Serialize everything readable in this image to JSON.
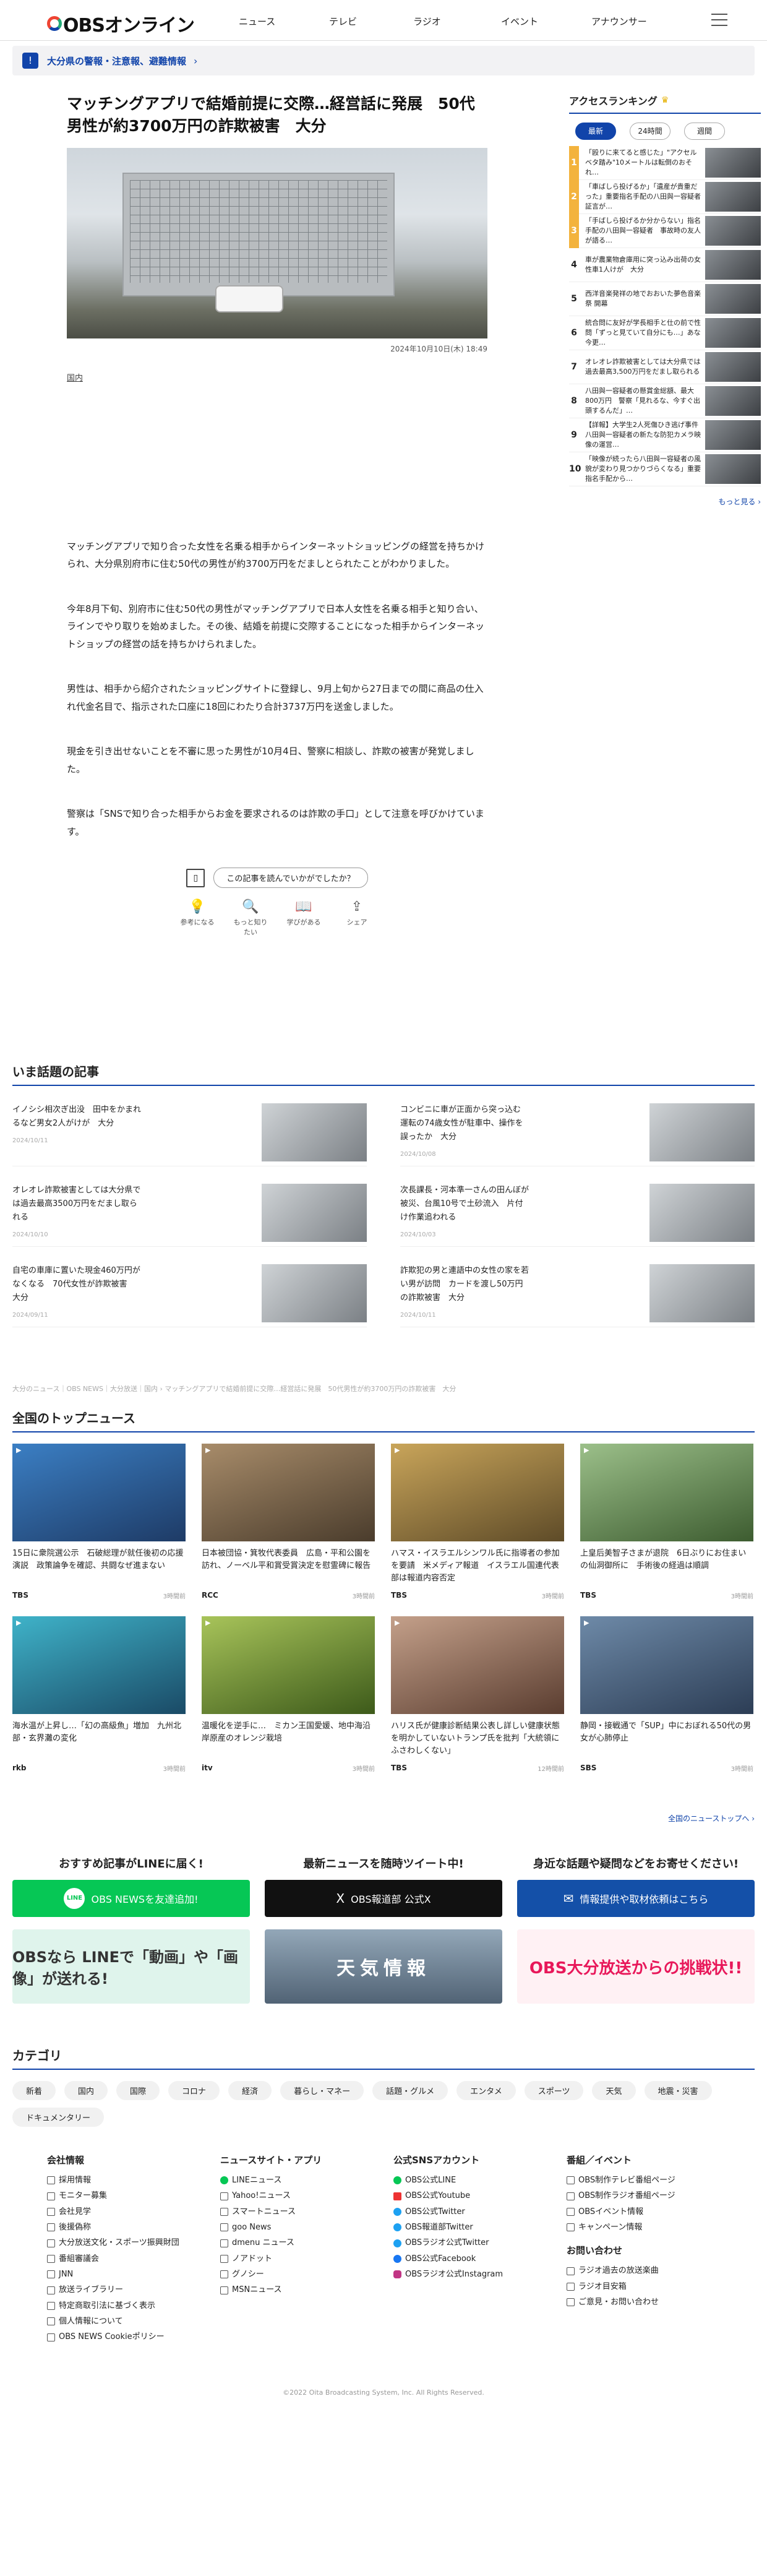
{
  "header": {
    "logo": "OBSオンライン",
    "nav": [
      "ニュース",
      "テレビ",
      "ラジオ",
      "イベント",
      "アナウンサー"
    ]
  },
  "alert": {
    "text": "大分県の警報・注意報、避難情報"
  },
  "article": {
    "title": "マッチングアプリで結婚前提に交際…経営話に発展　50代男性が約3700万円の詐欺被害　大分",
    "date": "2024年10月10日(木) 18:49",
    "category": "国内",
    "paragraphs": [
      "マッチングアプリで知り合った女性を名乗る相手からインターネットショッピングの経営を持ちかけられ、大分県別府市に住む50代の男性が約3700万円をだましとられたことがわかりました。",
      "今年8月下旬、別府市に住む50代の男性がマッチングアプリで日本人女性を名乗る相手と知り合い、ラインでやり取りを始めました。その後、結婚を前提に交際することになった相手からインターネットショップの経営の話を持ちかけられました。",
      "男性は、相手から紹介されたショッピングサイトに登録し、9月上旬から27日までの間に商品の仕入れ代金名目で、指示された口座に18回にわたり合計3737万円を送金しました。",
      "現金を引き出せないことを不審に思った男性が10月4日、警察に相談し、詐欺の被害が発覚しました。",
      "警察は「SNSで知り合った相手からお金を要求されるのは詐欺の手口」として注意を呼びかけています。"
    ],
    "survey": "この記事を読んでいかがでしたか？",
    "reactions": [
      "参考になる",
      "もっと知りたい",
      "学びがある",
      "シェア"
    ]
  },
  "ranking": {
    "title": "アクセスランキング",
    "tabs": [
      "最新",
      "24時間",
      "週間"
    ],
    "items": [
      {
        "rank": "1",
        "text": "「殴りに来てると感じた」\"アクセルベタ踏み\"10メートルは転倒のおそれ…"
      },
      {
        "rank": "2",
        "text": "「車ばしら投げるか」「遺産が貴重だった」重要指名手配の八田與一容疑者　証言が…"
      },
      {
        "rank": "3",
        "text": "「手ばしら投げるか分からない」指名手配の八田與一容疑者　事故時の友人が語る…"
      },
      {
        "rank": "4",
        "text": "車が農業物倉庫用に突っ込み出荷の女性車1人けが　大分"
      },
      {
        "rank": "5",
        "text": "西洋音楽発祥の地でおおいた夢色音楽祭 開幕"
      },
      {
        "rank": "6",
        "text": "統合問に友好が学長相手と仕の前で性問「ずっと見ていて自分にも…」あな今更…"
      },
      {
        "rank": "7",
        "text": "オレオレ詐欺被害としては大分県では過去最高3,500万円をだまし取られる"
      },
      {
        "rank": "8",
        "text": "八田與一容疑者の懸賞金総額、最大800万円　警察「見れるな、今すぐ出頭するんだ」…"
      },
      {
        "rank": "9",
        "text": "【詳報】大学生2人死傷ひき逃げ事件　八田與一容疑者の新たな防犯カメラ映像の運営…"
      },
      {
        "rank": "10",
        "text": "「映像が続ったら八田與一容疑者の風貌が変わり見つかりづらくなる」重要指名手配から…"
      }
    ],
    "more": "もっと見る ›"
  },
  "topics": {
    "title": "いま話題の記事",
    "items": [
      {
        "text": "イノシシ相次ぎ出没　田中をかまれるなど男女2人がけが　大分",
        "date": "2024/10/11"
      },
      {
        "text": "コンビニに車が正面から突っ込む　運転の74歳女性が駐車中、操作を誤ったか　大分",
        "date": "2024/10/08"
      },
      {
        "text": "オレオレ詐欺被害としては大分県では過去最高3500万円をだまし取られる",
        "date": "2024/10/10"
      },
      {
        "text": "次長課長・河本準一さんの田んぼが被災、台風10号で土砂流入　片付け作業追われる",
        "date": "2024/10/03"
      },
      {
        "text": "自宅の車庫に置いた現金460万円がなくなる　70代女性が詐欺被害　大分",
        "date": "2024/09/11"
      },
      {
        "text": "詐欺犯の男と連語中の女性の家を若い男が訪問　カードを渡し50万円の詐欺被害　大分",
        "date": "2024/10/11"
      }
    ]
  },
  "breadcrumb": "大分のニュース｜OBS NEWS｜大分放送｜国内 › マッチングアプリで結婚前提に交際…経営話に発展　50代男性が約3700万円の詐欺被害　大分",
  "top_news": {
    "title": "全国のトップニュース",
    "items": [
      {
        "text": "15日に衆院選公示　石破総理が就任後初の応援演説　政策論争を確認、共闘なぜ進まない",
        "source": "TBS",
        "time": "3時間前"
      },
      {
        "text": "日本被団協・箕牧代表委員　広島・平和公園を訪れ、ノーベル平和賞受賞決定を慰霊碑に報告",
        "source": "RCC",
        "time": "3時間前"
      },
      {
        "text": "ハマス・イスラエルシンワル氏に指導者の参加を要請　米メディア報道　イスラエル国連代表部は報道内容否定",
        "source": "TBS",
        "time": "3時間前"
      },
      {
        "text": "上皇后美智子さまが退院　6日ぶりにお住まいの仙洞御所に　手術後の経過は順調",
        "source": "TBS",
        "time": "3時間前"
      },
      {
        "text": "海水温が上昇し…「幻の高級魚」増加　九州北部・玄界灘の変化",
        "source": "rkb",
        "time": "3時間前"
      },
      {
        "text": "温暖化を逆手に…　ミカン王国愛媛、地中海沿岸原産のオレンジ栽培",
        "source": "itv",
        "time": "3時間前"
      },
      {
        "text": "ハリス氏が健康診断結果公表し詳しい健康状態を明かしていないトランプ氏を批判「大統領にふさわしくない」",
        "source": "TBS",
        "time": "12時間前"
      },
      {
        "text": "静岡・接戦通で「SUP」中におぼれる50代の男女が心肺停止",
        "source": "SBS",
        "time": "3時間前"
      }
    ],
    "all": "全国のニューストップへ ›"
  },
  "promo": {
    "cols": [
      {
        "title": "おすすめ記事がLINEに届く!",
        "button": "OBS NEWSを友達追加!",
        "badge": "LINE"
      },
      {
        "title": "最新ニュースを随時ツイート中!",
        "button": "OBS報道部 公式X",
        "badge": "X"
      },
      {
        "title": "身近な話題や疑問などをお寄せください!",
        "button": "情報提供や取材依頼はこちら",
        "badge": "✉"
      }
    ],
    "banners": [
      "OBSなら LINEで「動画」や「画像」が送れる!",
      "天気情報",
      "OBS大分放送からの挑戦状!!"
    ]
  },
  "categories": {
    "title": "カテゴリ",
    "items": [
      "新着",
      "国内",
      "国際",
      "コロナ",
      "経済",
      "暮らし・マネー",
      "話題・グルメ",
      "エンタメ",
      "スポーツ",
      "天気",
      "地震・災害",
      "ドキュメンタリー"
    ]
  },
  "footer": {
    "cols": [
      {
        "title": "会社情報",
        "links": [
          "採用情報",
          "モニター募集",
          "会社見学",
          "後援偽称",
          "大分放送文化・スポーツ振興財団",
          "番組審議会",
          "JNN",
          "放送ライブラリー",
          "特定商取引法に基づく表示",
          "個人情報について",
          "OBS NEWS Cookieポリシー"
        ]
      },
      {
        "title": "ニュースサイト・アプリ",
        "links": [
          "LINEニュース",
          "Yahoo!ニュース",
          "スマートニュース",
          "goo News",
          "dmenu ニュース",
          "ノアドット",
          "グノシー",
          "MSNニュース"
        ]
      },
      {
        "title": "公式SNSアカウント",
        "links": [
          "OBS公式LINE",
          "OBS公式Youtube",
          "OBS公式Twitter",
          "OBS報道部Twitter",
          "OBSラジオ公式Twitter",
          "OBS公式Facebook",
          "OBSラジオ公式Instagram"
        ]
      },
      {
        "title": "番組／イベント",
        "links": [
          "OBS制作テレビ番組ページ",
          "OBS制作ラジオ番組ページ",
          "OBSイベント情報",
          "キャンペーン情報"
        ],
        "title2": "お問い合わせ",
        "links2": [
          "ラジオ過去の放送楽曲",
          "ラジオ目安箱",
          "ご意見・お問い合わせ"
        ]
      }
    ],
    "copyright": "©2022 Oita Broadcasting System, Inc. All Rights Reserved."
  },
  "colors": {
    "brand": "#1444aa",
    "line": "#06c755",
    "rank_top": "#f3b33d"
  }
}
